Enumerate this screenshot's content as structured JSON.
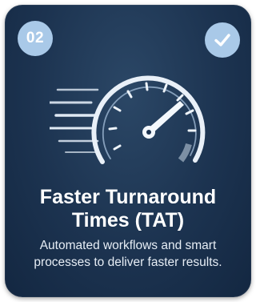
{
  "card": {
    "number": "02",
    "title_line1": "Faster Turnaround",
    "title_line2": "Times (TAT)",
    "description": "Automated workflows and smart processes to deliver faster results.",
    "icons": {
      "top_right": "check-icon",
      "illustration": "speedometer-icon"
    },
    "colors": {
      "card_background": "#1c3350",
      "badge": "#a9c9e8",
      "text": "#ffffff"
    }
  }
}
